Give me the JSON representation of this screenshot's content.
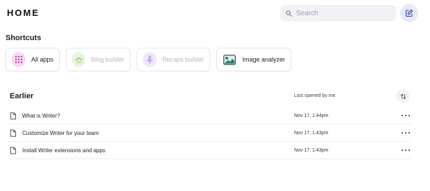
{
  "header": {
    "title": "HOME",
    "search_placeholder": "Search"
  },
  "shortcuts": {
    "title": "Shortcuts",
    "items": [
      {
        "label": "All apps",
        "icon": "grid-icon",
        "enabled": true
      },
      {
        "label": "Blog builder",
        "icon": "blog-builder-icon",
        "enabled": false
      },
      {
        "label": "Recaps builder",
        "icon": "microphone-icon",
        "enabled": false
      },
      {
        "label": "Image analyzer",
        "icon": "image-icon",
        "enabled": true
      }
    ]
  },
  "earlier": {
    "title": "Earlier",
    "column_label": "Last opened by me",
    "rows": [
      {
        "name": "What is Writer?",
        "date": "Nov 17, 1:44pm"
      },
      {
        "name": "Customize Writer for your team",
        "date": "Nov 17, 1:43pm"
      },
      {
        "name": "Install Writer extensions and apps",
        "date": "Nov 17, 1:43pm"
      }
    ]
  },
  "colors": {
    "accent_bg": "#e7e9fb",
    "search_bg": "#f1f2f6",
    "divider": "#ececef"
  }
}
